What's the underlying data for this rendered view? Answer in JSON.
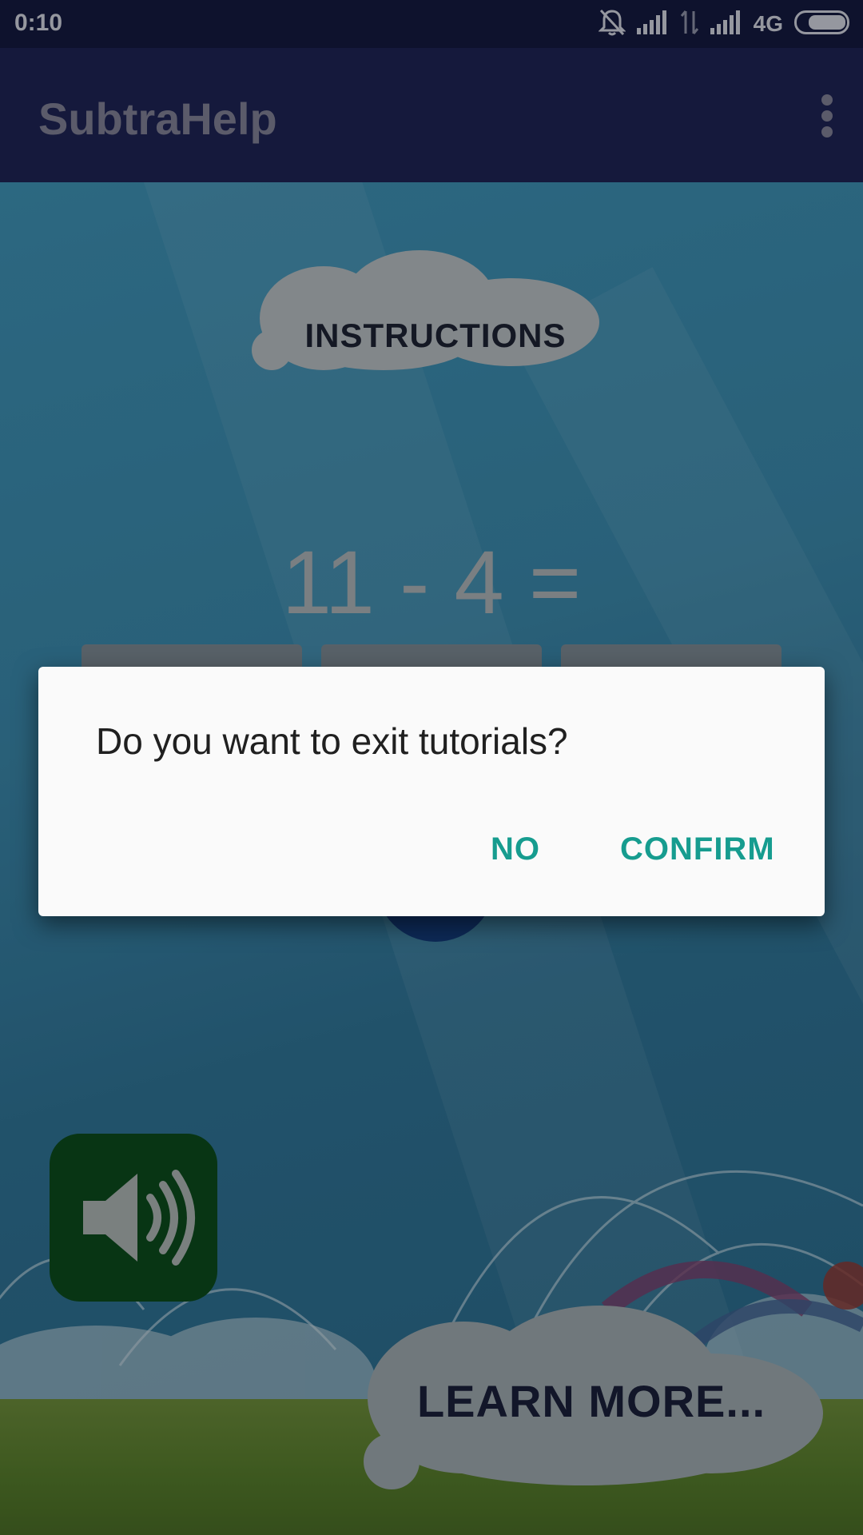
{
  "status_bar": {
    "time": "0:10",
    "network": "4G",
    "icons": [
      "bell-off-icon",
      "signal-icon",
      "data-transfer-icon",
      "signal-icon",
      "battery-icon"
    ]
  },
  "app_bar": {
    "title": "SubtraHelp",
    "menu_icon": "overflow-menu-icon"
  },
  "game": {
    "instructions_label": "INSTRUCTIONS",
    "equation": "11 - 4 =",
    "learn_more_label": "LEARN MORE...",
    "sound_icon": "speaker-icon"
  },
  "dialog": {
    "message": "Do you want to exit tutorials?",
    "no_label": "NO",
    "confirm_label": "CONFIRM",
    "accent_color": "#169c8f"
  }
}
